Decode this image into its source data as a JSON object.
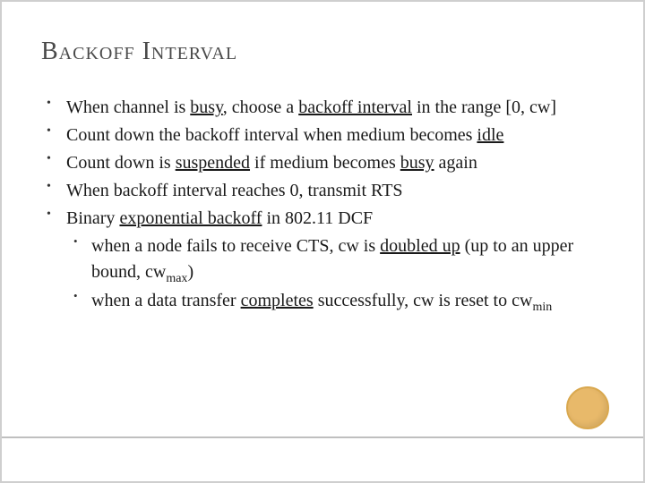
{
  "title": "Backoff Interval",
  "bullets": {
    "b1_a": "When channel is ",
    "b1_b": "busy",
    "b1_c": ", choose a ",
    "b1_d": "backoff interval",
    "b1_e": " in the range [0, cw]",
    "b2_a": "Count down the backoff interval when medium becomes ",
    "b2_b": "idle",
    "b3_a": "Count down is ",
    "b3_b": "suspended",
    "b3_c": " if medium becomes ",
    "b3_d": "busy",
    "b3_e": " again",
    "b4": "When backoff interval reaches 0, transmit RTS",
    "b5_a": "Binary ",
    "b5_b": "exponential backoff",
    "b5_c": " in 802.11 DCF",
    "b5s1_a": "when a node fails to receive CTS, cw is ",
    "b5s1_b": "doubled up",
    "b5s1_c": " (up to an upper bound, cw",
    "b5s1_d": "max",
    "b5s1_e": ")",
    "b5s2_a": "when a data transfer ",
    "b5s2_b": "completes",
    "b5s2_c": " successfully, cw is reset to cw",
    "b5s2_d": "min"
  }
}
